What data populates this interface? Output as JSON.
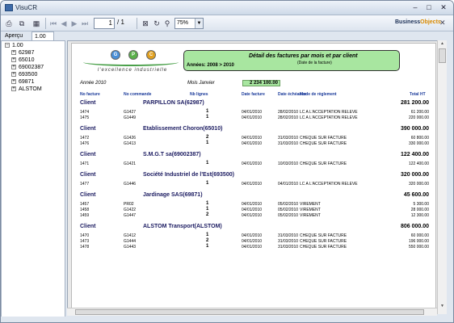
{
  "window": {
    "title": "VisuCR",
    "minimize": "–",
    "maximize": "□",
    "close": "✕"
  },
  "toolbar": {
    "page_current": "1",
    "page_total": "/ 1",
    "zoom": "75%",
    "brand_main": "Business",
    "brand_accent": "Objects",
    "close_report": "✕"
  },
  "tabs": [
    {
      "label": "Aperçu"
    },
    {
      "label": "1.00"
    }
  ],
  "tree": {
    "root": "1.00",
    "items": [
      "62987",
      "65010",
      "69002387",
      "693500",
      "69871",
      "ALSTOM"
    ]
  },
  "report": {
    "logo_letters": [
      "G",
      "P",
      "C"
    ],
    "tagline": "l'excellence industrielle",
    "title": "Détail des factures par mois et par client",
    "subtitle": "(Date de la facture)",
    "years_label": "Années: 2008 > 2010",
    "year": "Année 2010",
    "month": "Mois Janvier",
    "month_total": "2 234 100.00",
    "columns": [
      "No facture",
      "No commande",
      "Nb lignes",
      "Date facture",
      "Date échéance",
      "Mode de règlement",
      "Total HT"
    ],
    "client_label": "Client",
    "clients": [
      {
        "name": "PARPILLON SA(62987)",
        "total": "281 200.00",
        "rows": [
          [
            "1474",
            "G1427",
            "1",
            "04/01/2010",
            "28/02/2010",
            "LC A L'ACCEPTATION RELEVE",
            "61 200.00"
          ],
          [
            "1475",
            "G1449",
            "1",
            "04/01/2010",
            "28/02/2010",
            "LC A L'ACCEPTATION RELEVE",
            "220 000.00"
          ]
        ]
      },
      {
        "name": "Etablissement Choron(65010)",
        "total": "390 000.00",
        "rows": [
          [
            "1472",
            "G1426",
            "2",
            "04/01/2010",
            "31/03/2010",
            "CHEQUE SUR FACTURE",
            "60 800.00"
          ],
          [
            "1476",
            "G1413",
            "1",
            "04/01/2010",
            "31/03/2010",
            "CHEQUE SUR FACTURE",
            "330 000.00"
          ]
        ]
      },
      {
        "name": "S.M.G.T sa(69002387)",
        "total": "122 400.00",
        "rows": [
          [
            "1471",
            "G1421",
            "1",
            "04/01/2010",
            "10/03/2010",
            "CHEQUE SUR FACTURE",
            "122 400.00"
          ]
        ]
      },
      {
        "name": "Société Industriel de l'Est(693500)",
        "total": "320 000.00",
        "rows": [
          [
            "1477",
            "G1446",
            "1",
            "04/01/2010",
            "04/01/2010",
            "LC A L'ACCEPTATION RELEVE",
            "320 000.00"
          ]
        ]
      },
      {
        "name": "Jardinage SAS(69871)",
        "total": "45 600.00",
        "rows": [
          [
            "1457",
            "PR02",
            "1",
            "04/01/2010",
            "05/02/2010",
            "VIREMENT",
            "5 300.00"
          ],
          [
            "1458",
            "G1422",
            "1",
            "04/01/2010",
            "05/02/2010",
            "VIREMENT",
            "28 000.00"
          ],
          [
            "1459",
            "G1447",
            "2",
            "04/01/2010",
            "05/02/2010",
            "VIREMENT",
            "12 300.00"
          ]
        ]
      },
      {
        "name": "ALSTOM Transport(ALSTOM)",
        "total": "806 000.00",
        "rows": [
          [
            "1470",
            "G1412",
            "1",
            "04/01/2010",
            "31/03/2010",
            "CHEQUE SUR FACTURE",
            "60 000.00"
          ],
          [
            "1473",
            "G1444",
            "2",
            "04/01/2010",
            "31/03/2010",
            "CHEQUE SUR FACTURE",
            "196 000.00"
          ],
          [
            "1478",
            "G1443",
            "1",
            "04/01/2010",
            "31/03/2010",
            "CHEQUE SUR FACTURE",
            "550 000.00"
          ]
        ]
      }
    ]
  }
}
